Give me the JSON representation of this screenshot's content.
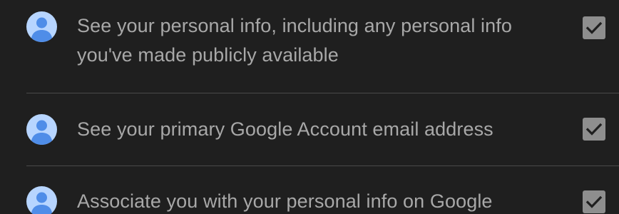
{
  "scopes": [
    {
      "icon": "account-avatar-icon",
      "text": "See your personal info, including any personal info\nyou've made publicly available",
      "checked": true
    },
    {
      "icon": "account-avatar-icon",
      "text": "See your primary Google Account email address",
      "checked": true
    },
    {
      "icon": "account-avatar-icon",
      "text": "Associate you with your personal info on Google",
      "checked": true
    }
  ],
  "colors": {
    "background": "#1f1f1f",
    "text": "#a8a8a8",
    "avatar_bg": "#b7d5ff",
    "avatar_fg": "#4f8de8",
    "checkbox": "#8e8e8e",
    "divider": "#4a4a4a"
  }
}
